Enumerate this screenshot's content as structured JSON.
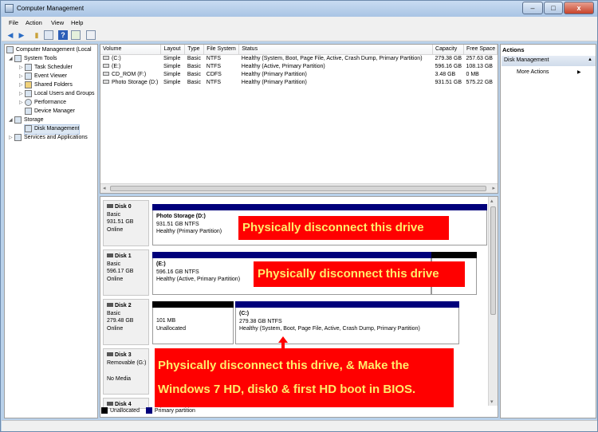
{
  "window": {
    "title": "Computer Management",
    "controls": {
      "minimize": "–",
      "maximize": "□",
      "close": "x"
    }
  },
  "menu": [
    "File",
    "Action",
    "View",
    "Help"
  ],
  "toolbar_icons": [
    "back-icon",
    "forward-icon",
    "up-folder-icon",
    "properties-icon",
    "help-icon",
    "export-icon",
    "view-icon"
  ],
  "tree": {
    "root": "Computer Management (Local",
    "system_tools": "System Tools",
    "items": [
      "Task Scheduler",
      "Event Viewer",
      "Shared Folders",
      "Local Users and Groups",
      "Performance",
      "Device Manager"
    ],
    "storage": "Storage",
    "disk_management": "Disk Management",
    "services": "Services and Applications"
  },
  "volumes": {
    "headers": [
      "Volume",
      "Layout",
      "Type",
      "File System",
      "Status",
      "Capacity",
      "Free Space"
    ],
    "rows": [
      [
        "(C:)",
        "Simple",
        "Basic",
        "NTFS",
        "Healthy (System, Boot, Page File, Active, Crash Dump, Primary Partition)",
        "279.38 GB",
        "257.63 GB"
      ],
      [
        "(E:)",
        "Simple",
        "Basic",
        "NTFS",
        "Healthy (Active, Primary Partition)",
        "596.16 GB",
        "108.13 GB"
      ],
      [
        "CD_ROM (F:)",
        "Simple",
        "Basic",
        "CDFS",
        "Healthy (Primary Partition)",
        "3.48 GB",
        "0 MB"
      ],
      [
        "Photo Storage (D:)",
        "Simple",
        "Basic",
        "NTFS",
        "Healthy (Primary Partition)",
        "931.51 GB",
        "575.22 GB"
      ]
    ]
  },
  "disks": {
    "disk0": {
      "name": "Disk 0",
      "type": "Basic",
      "size": "931.51 GB",
      "state": "Online",
      "part1": {
        "name": "Photo Storage  (D:)",
        "size": "931.51 GB NTFS",
        "status": "Healthy (Primary Partition)"
      }
    },
    "disk1": {
      "name": "Disk 1",
      "type": "Basic",
      "size": "596.17 GB",
      "state": "Online",
      "part1": {
        "name": "(E:)",
        "size": "596.16 GB NTFS",
        "status": "Healthy (Active, Primary Partition)"
      }
    },
    "disk2": {
      "name": "Disk 2",
      "type": "Basic",
      "size": "279.48 GB",
      "state": "Online",
      "part1": {
        "size": "101 MB",
        "status": "Unallocated"
      },
      "part2": {
        "name": "(C:)",
        "size": "279.38 GB NTFS",
        "status": "Healthy (System, Boot, Page File, Active, Crash Dump, Primary Partition)"
      }
    },
    "disk3": {
      "name": "Disk 3",
      "type": "Removable (G:)",
      "media": "No Media"
    },
    "disk4": {
      "name": "Disk 4"
    }
  },
  "legend": {
    "unallocated": "Unallocated",
    "primary": "Primary partition"
  },
  "callouts": {
    "c1": "Physically disconnect this drive",
    "c2": "Physically disconnect this drive",
    "c3_line1": "Physically disconnect this drive, & Make the",
    "c3_line2": "Windows 7 HD, disk0 & first HD boot in BIOS."
  },
  "actions": {
    "title": "Actions",
    "section": "Disk Management",
    "more": "More Actions"
  },
  "colors": {
    "callout_bg": "#ff0000",
    "callout_text": "#ffeb6b",
    "primary_partition": "#00007b",
    "unallocated": "#000000"
  }
}
